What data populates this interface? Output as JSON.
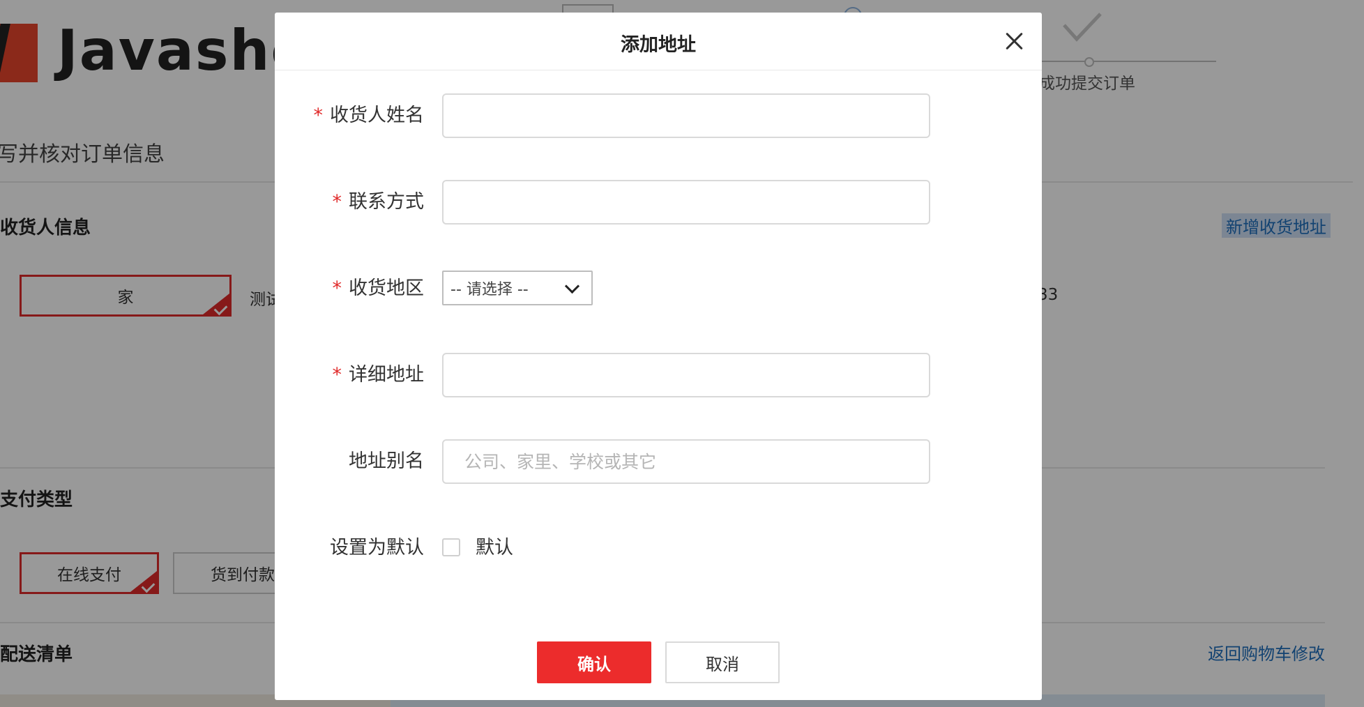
{
  "background": {
    "logo_text": "Javashop",
    "steps": {
      "last_label": "成功提交订单"
    },
    "page_heading": "写并核对订单信息",
    "receiver_section": {
      "title": "收货人信息",
      "add_link": "新增收货地址",
      "selected_address": "家",
      "address_text_fragment": "测试",
      "phone_fragment": "33"
    },
    "payment_section": {
      "title": "支付类型",
      "options": [
        "在线支付",
        "货到付款"
      ]
    },
    "delivery_section": {
      "title": "配送清单",
      "back_link": "返回购物车修改"
    }
  },
  "modal": {
    "title": "添加地址",
    "fields": {
      "name": {
        "label": "收货人姓名",
        "required": true,
        "value": ""
      },
      "phone": {
        "label": "联系方式",
        "required": true,
        "value": ""
      },
      "region": {
        "label": "收货地区",
        "required": true,
        "selected": "-- 请选择 --"
      },
      "detail": {
        "label": "详细地址",
        "required": true,
        "value": ""
      },
      "alias": {
        "label": "地址别名",
        "required": false,
        "value": "",
        "placeholder": "公司、家里、学校或其它"
      },
      "default": {
        "label": "设置为默认",
        "checkbox_label": "默认",
        "checked": false
      }
    },
    "required_mark": "*",
    "buttons": {
      "confirm": "确认",
      "cancel": "取消"
    }
  },
  "colors": {
    "accent_red": "#ec2c2c",
    "link_blue": "#1e6fbd",
    "overlay": "rgba(0,0,0,0.4)"
  }
}
